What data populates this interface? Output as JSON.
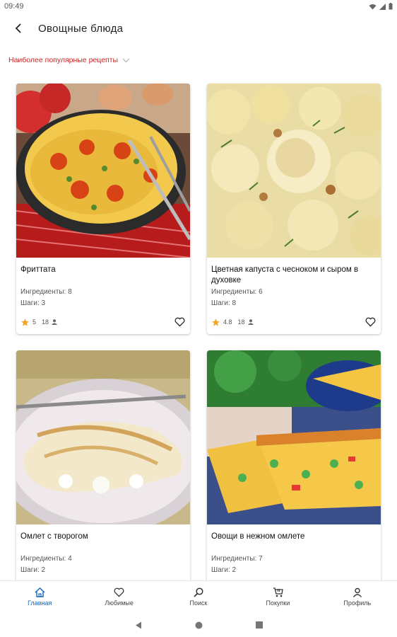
{
  "status_bar": {
    "time": "09:49"
  },
  "header": {
    "title": "Овощные  блюда"
  },
  "filter": {
    "label": "Наиболее популярные рецепты"
  },
  "recipes": [
    {
      "title": "Фриттата",
      "ingredients": "Ингредиенты: 8",
      "steps": "Шаги: 3",
      "rating": "5",
      "count": "18",
      "image_icon": "frittata-photo"
    },
    {
      "title": "Цветная капуста с чесноком и сыром в духовке",
      "ingredients": "Ингредиенты: 6",
      "steps": "Шаги: 8",
      "rating": "4.8",
      "count": "18",
      "image_icon": "cauliflower-photo"
    },
    {
      "title": "Омлет с творогом",
      "ingredients": "Ингредиенты: 4",
      "steps": "Шаги: 2",
      "image_icon": "omelette-photo"
    },
    {
      "title": "Овощи в нежном омлете",
      "ingredients": "Ингредиенты: 7",
      "steps": "Шаги: 2",
      "image_icon": "vegetable-omelette-photo"
    }
  ],
  "bottom_nav": [
    {
      "label": "Главная",
      "icon": "home-icon"
    },
    {
      "label": "Любимые",
      "icon": "heart-icon"
    },
    {
      "label": "Поиск",
      "icon": "search-icon"
    },
    {
      "label": "Покупки",
      "icon": "cart-icon"
    },
    {
      "label": "Профиль",
      "icon": "person-icon"
    }
  ],
  "colors": {
    "accent": "#1565c0",
    "filter_text": "#c62828",
    "star": "#f5a623"
  }
}
